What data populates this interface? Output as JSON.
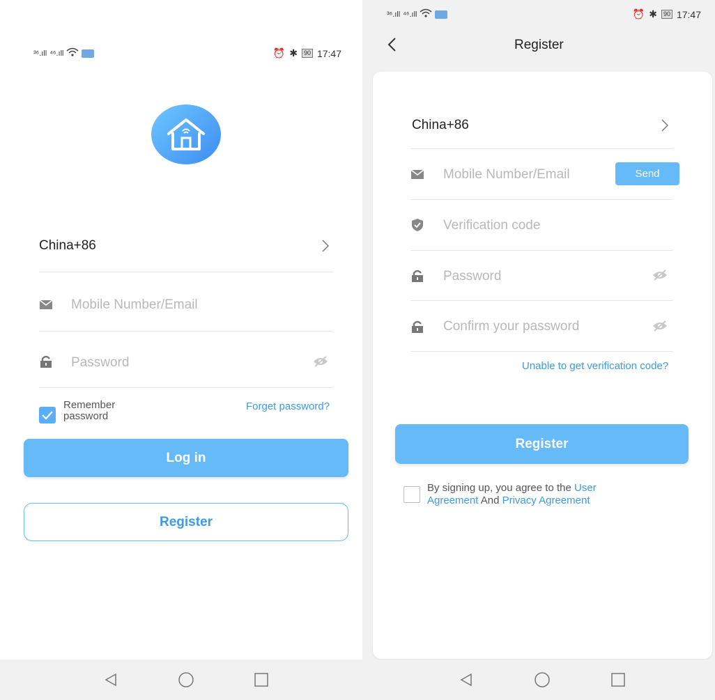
{
  "left": {
    "status": {
      "signal": "⁴⁶",
      "time": "17:47",
      "battery": "90"
    },
    "country": {
      "value": "China+86"
    },
    "account": {
      "placeholder": "Mobile Number/Email"
    },
    "password": {
      "placeholder": "Password"
    },
    "remember": {
      "label1": "Remember",
      "label2": "password",
      "checked": true
    },
    "forget": "Forget password?",
    "login_button": "Log in",
    "register_button": "Register"
  },
  "right": {
    "status": {
      "time": "17:47",
      "battery": "90"
    },
    "header": {
      "title": "Register"
    },
    "country": {
      "value": "China+86"
    },
    "account": {
      "placeholder": "Mobile Number/Email",
      "send_label": "Send"
    },
    "verification": {
      "placeholder": "Verification code"
    },
    "password": {
      "placeholder": "Password"
    },
    "confirm": {
      "placeholder": "Confirm your password"
    },
    "unable_link": "Unable to get verification code?",
    "register_button": "Register",
    "agreement": {
      "text1": "By signing up, you agree to the",
      "link1a": "User",
      "link1b": "Agreement",
      "and": "And",
      "link2": "Privacy Agreement"
    }
  },
  "colors": {
    "accent": "#66baf8",
    "link": "#3d9ae8"
  },
  "icons": [
    "mail-icon",
    "lock-icon",
    "eye-off-icon",
    "shield-icon",
    "chevron-right-icon",
    "back-icon",
    "home-logo-icon"
  ]
}
